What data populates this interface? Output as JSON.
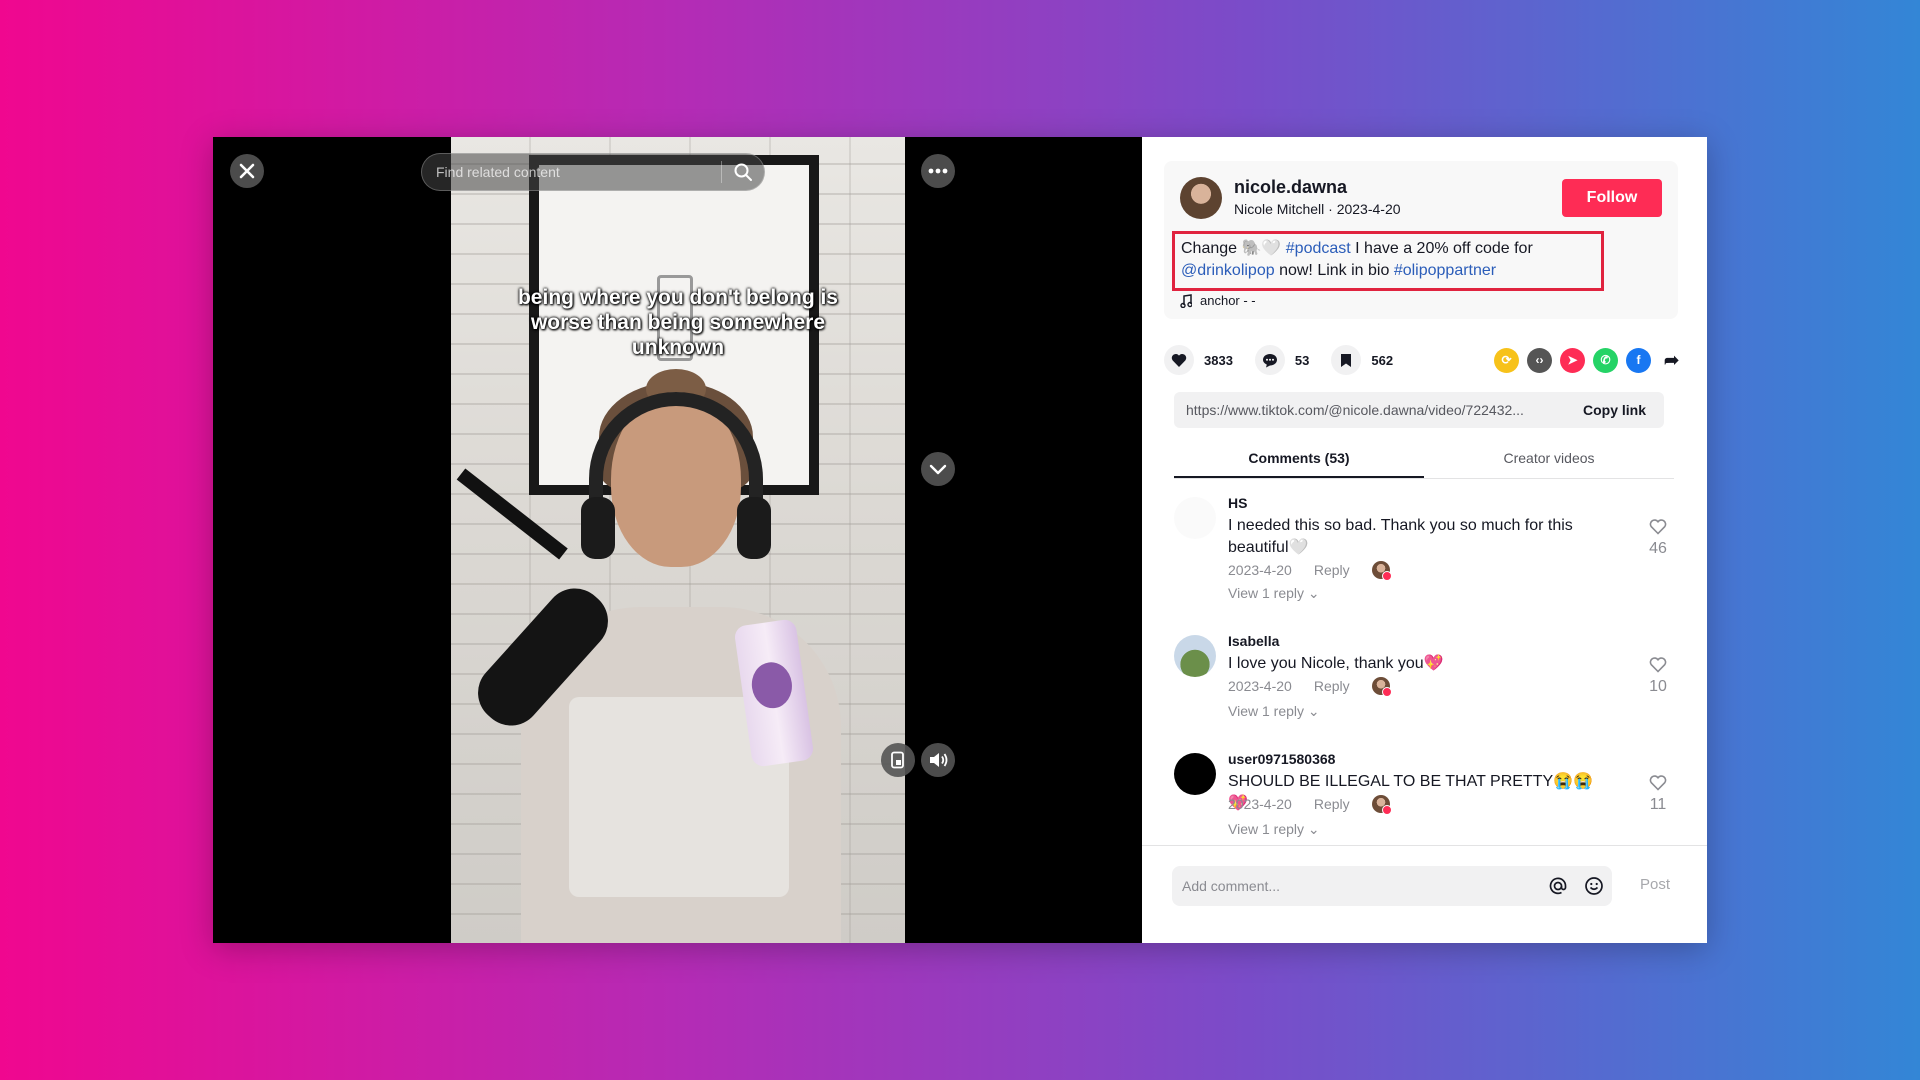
{
  "player": {
    "search_placeholder": "Find related content",
    "caption_text": "being where you don't belong is worse than being somewhere unknown"
  },
  "author": {
    "username": "nicole.dawna",
    "display_name": "Nicole Mitchell",
    "date": "2023-4-20",
    "separator": " · ",
    "follow_label": "Follow"
  },
  "description": {
    "text_1": "Change 🐘🤍 ",
    "tag_podcast": "#podcast",
    "text_2": " I have a 20% off code for ",
    "mention": "@drinkolipop",
    "text_3": " now! Link in bio ",
    "tag_partner": "#olipoppartner",
    "highlight_color": "#e0233f"
  },
  "music": {
    "label": "anchor - -"
  },
  "stats": {
    "likes": "3833",
    "comments": "53",
    "saves": "562"
  },
  "share": {
    "link": "https://www.tiktok.com/@nicole.dawna/video/722432...",
    "copy_label": "Copy link",
    "icons": [
      "repost-icon",
      "embed-icon",
      "send-icon",
      "whatsapp-icon",
      "facebook-icon",
      "share-arrow-icon"
    ]
  },
  "tabs": {
    "comments": "Comments (53)",
    "creator_videos": "Creator videos"
  },
  "comments": [
    {
      "name": "HS",
      "text": "I needed this so bad. Thank you so much for this beautiful🤍",
      "date": "2023-4-20",
      "reply": "Reply",
      "view_replies": "View 1 reply",
      "likes": "46"
    },
    {
      "name": "Isabella",
      "text": "I love you Nicole, thank you💖",
      "date": "2023-4-20",
      "reply": "Reply",
      "view_replies": "View 1 reply",
      "likes": "10"
    },
    {
      "name": "user0971580368",
      "text": "SHOULD BE ILLEGAL TO BE THAT PRETTY😭😭💖",
      "date": "2023-4-20",
      "reply": "Reply",
      "view_replies": "View 1 reply",
      "likes": "11"
    }
  ],
  "composer": {
    "placeholder": "Add comment...",
    "post_label": "Post"
  },
  "colors": {
    "follow": "#fe2c55",
    "tag": "#2b5db9"
  }
}
